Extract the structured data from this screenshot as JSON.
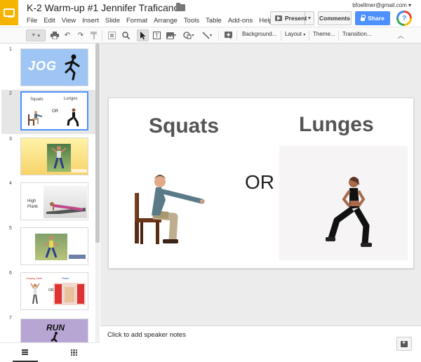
{
  "header": {
    "title": "K-2 Warm-up #1 Jennifer Traficano",
    "account": "bfoellmer@gmail.com",
    "menu": [
      "File",
      "Edit",
      "View",
      "Insert",
      "Slide",
      "Format",
      "Arrange",
      "Tools",
      "Table",
      "Add-ons",
      "Help"
    ],
    "present_label": "Present",
    "comments_label": "Comments",
    "share_label": "Share",
    "avatar_letter": "?"
  },
  "toolbar": {
    "background_label": "Background...",
    "layout_label": "Layout",
    "theme_label": "Theme...",
    "transition_label": "Transition..."
  },
  "filmstrip": {
    "slides": [
      {
        "number": "1",
        "text": "JOG"
      },
      {
        "number": "2",
        "left": "Squats",
        "middle": "OR",
        "right": "Lunges"
      },
      {
        "number": "3",
        "caption": ""
      },
      {
        "number": "4",
        "text": "High Plank"
      },
      {
        "number": "5"
      },
      {
        "number": "6",
        "left": "Jumping Jacks",
        "middle": "OR",
        "right": "Pilates"
      },
      {
        "number": "7",
        "text": "RUN"
      }
    ]
  },
  "slide": {
    "title_left": "Squats",
    "middle": "OR",
    "title_right": "Lunges"
  },
  "notes": {
    "placeholder": "Click to add speaker notes"
  },
  "colors": {
    "slides_yellow": "#f4b400",
    "share_blue": "#4d90fe",
    "selected_blue": "#4d90fe"
  }
}
